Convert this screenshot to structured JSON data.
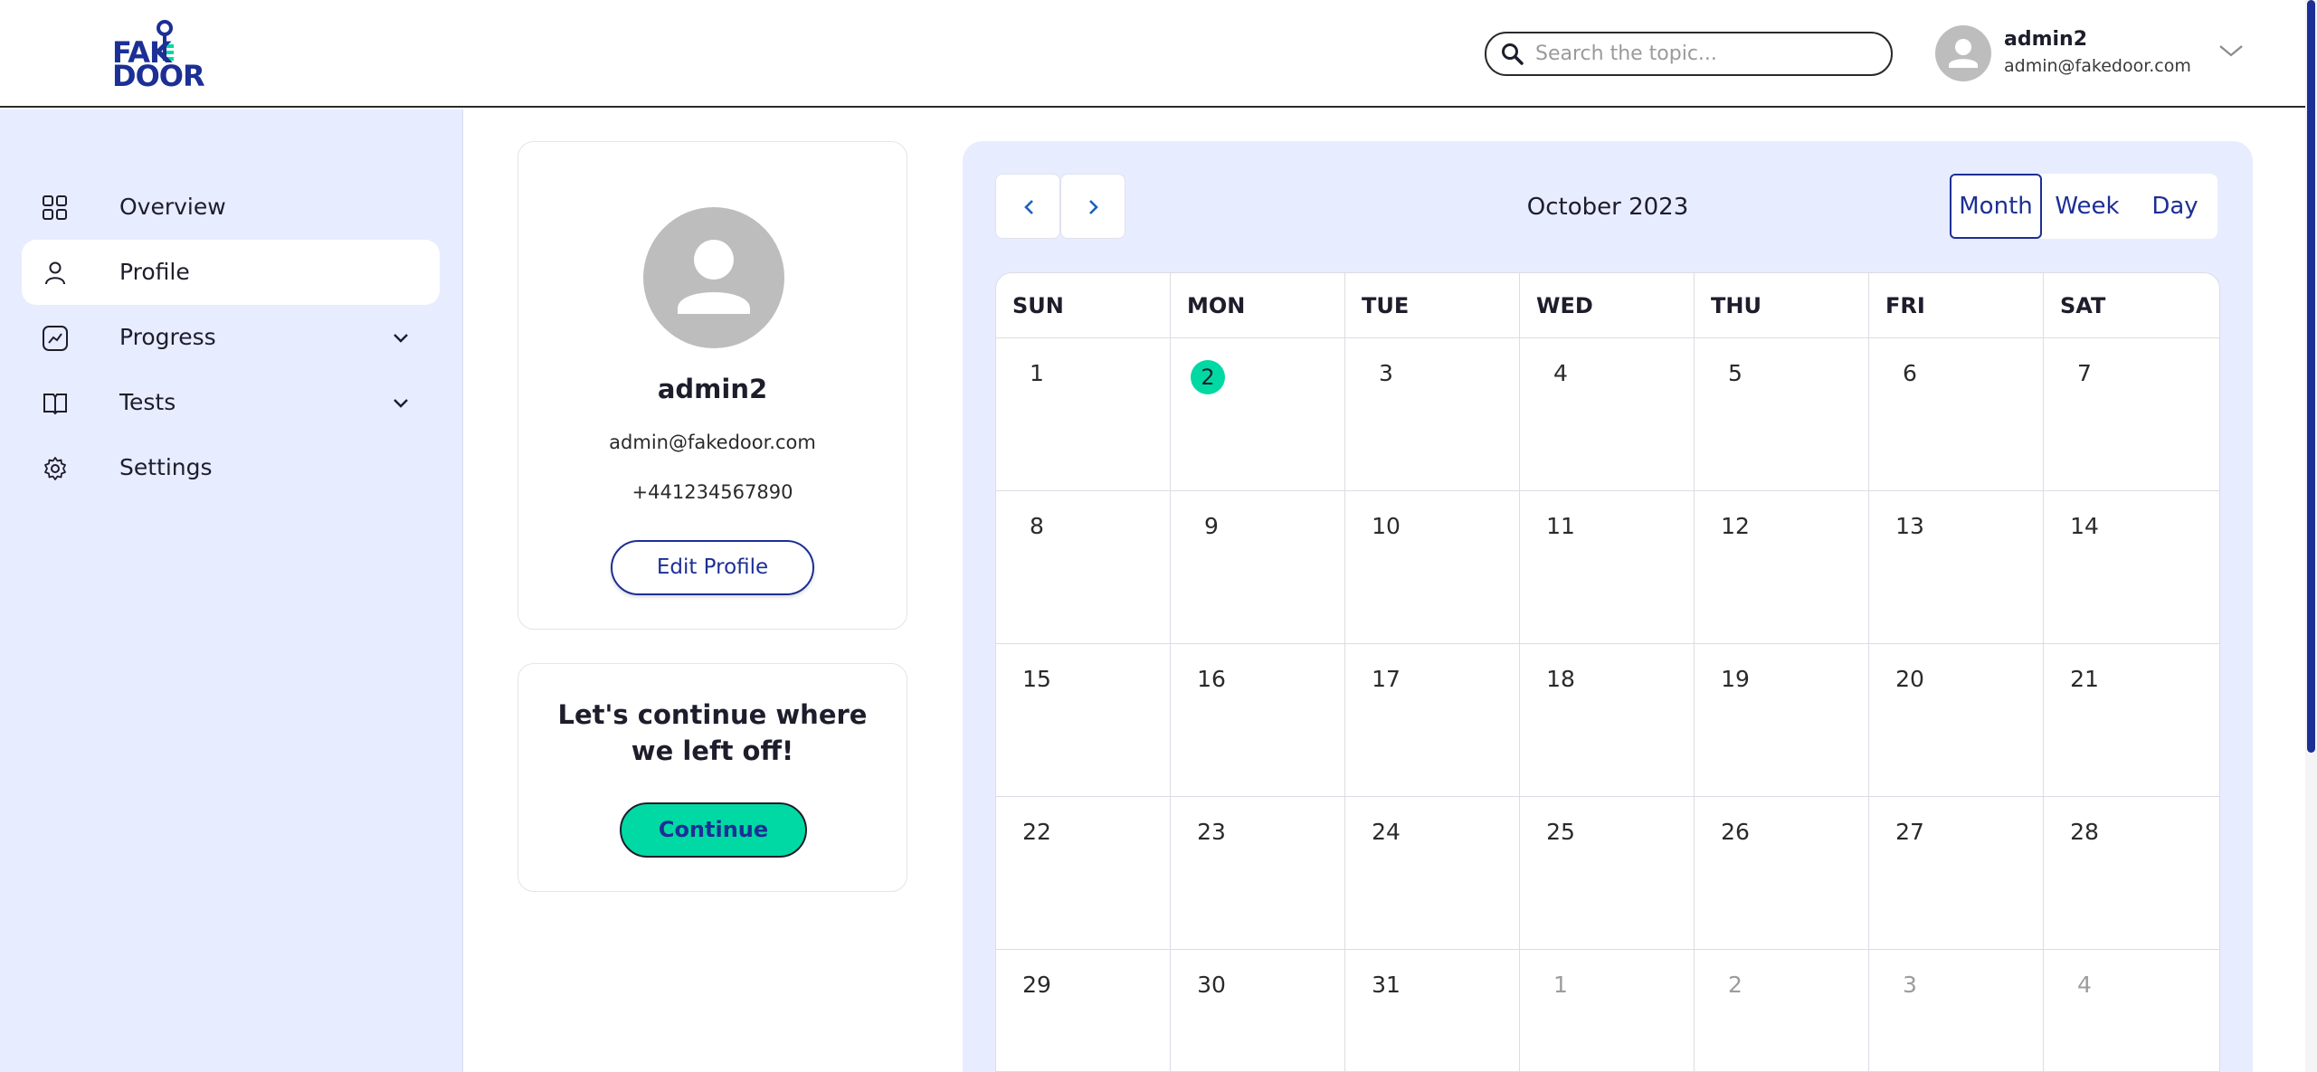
{
  "header": {
    "logo_line1": "FAK",
    "logo_line2": "DOOR",
    "search_placeholder": "Search the topic...",
    "user_name": "admin2",
    "user_email": "admin@fakedoor.com"
  },
  "sidebar": {
    "items": [
      {
        "label": "Overview",
        "icon": "grid-icon",
        "active": false,
        "expandable": false
      },
      {
        "label": "Profile",
        "icon": "person-icon",
        "active": true,
        "expandable": false
      },
      {
        "label": "Progress",
        "icon": "chart-icon",
        "active": false,
        "expandable": true
      },
      {
        "label": "Tests",
        "icon": "book-icon",
        "active": false,
        "expandable": true
      },
      {
        "label": "Settings",
        "icon": "gear-icon",
        "active": false,
        "expandable": false
      }
    ]
  },
  "profile": {
    "name": "admin2",
    "email": "admin@fakedoor.com",
    "phone": "+441234567890",
    "edit_label": "Edit Profile"
  },
  "continue_card": {
    "title": "Let's continue where we left off!",
    "button_label": "Continue"
  },
  "calendar": {
    "title": "October 2023",
    "views": [
      "Month",
      "Week",
      "Day"
    ],
    "active_view": "Month",
    "weekdays": [
      "SUN",
      "MON",
      "TUE",
      "WED",
      "THU",
      "FRI",
      "SAT"
    ],
    "weeks": [
      [
        "1",
        "2",
        "3",
        "4",
        "5",
        "6",
        "7"
      ],
      [
        "8",
        "9",
        "10",
        "11",
        "12",
        "13",
        "14"
      ],
      [
        "15",
        "16",
        "17",
        "18",
        "19",
        "20",
        "21"
      ],
      [
        "22",
        "23",
        "24",
        "25",
        "26",
        "27",
        "28"
      ],
      [
        "29",
        "30",
        "31",
        "1",
        "2",
        "3",
        "4"
      ]
    ],
    "today": "2",
    "other_month_from_index": 3
  },
  "colors": {
    "brand": "#1c2f95",
    "accent": "#00d9a3",
    "sidebar_bg": "#e8ecff"
  }
}
